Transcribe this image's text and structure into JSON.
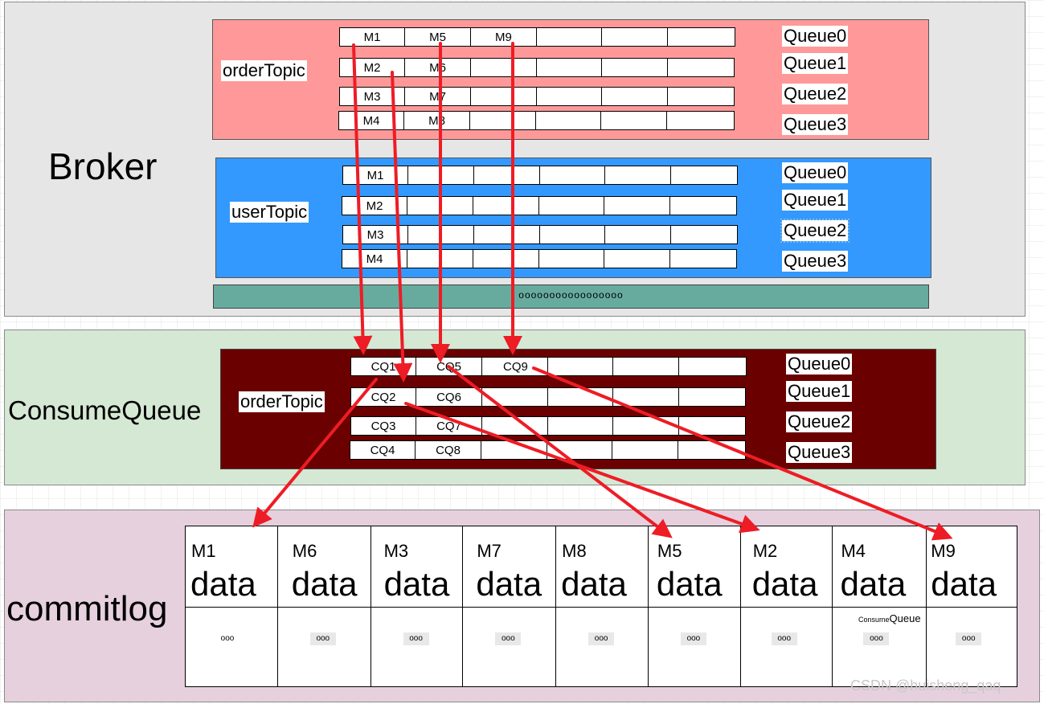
{
  "sections": {
    "broker": "Broker",
    "consume_queue": "ConsumeQueue",
    "commitlog": "commitlog"
  },
  "order_topic": {
    "label": "orderTopic",
    "queues": [
      {
        "name": "Queue0",
        "cells": [
          "M1",
          "M5",
          "M9",
          "",
          "",
          ""
        ]
      },
      {
        "name": "Queue1",
        "cells": [
          "M2",
          "M6",
          "",
          "",
          "",
          ""
        ]
      },
      {
        "name": "Queue2",
        "cells": [
          "M3",
          "M7",
          "",
          "",
          "",
          ""
        ]
      },
      {
        "name": "Queue3",
        "cells": [
          "M4",
          "M8",
          "",
          "",
          "",
          ""
        ]
      }
    ]
  },
  "user_topic": {
    "label": "userTopic",
    "queues": [
      {
        "name": "Queue0",
        "cells": [
          "M1",
          "",
          "",
          "",
          "",
          ""
        ]
      },
      {
        "name": "Queue1",
        "cells": [
          "M2",
          "",
          "",
          "",
          "",
          ""
        ]
      },
      {
        "name": "Queue2",
        "cells": [
          "M3",
          "",
          "",
          "",
          "",
          ""
        ]
      },
      {
        "name": "Queue3",
        "cells": [
          "M4",
          "",
          "",
          "",
          "",
          ""
        ]
      }
    ]
  },
  "more_topics": "ooooooooooooooooo",
  "consume_queue": {
    "label": "orderTopic",
    "queues": [
      {
        "name": "Queue0",
        "cells": [
          "CQ1",
          "CQ5",
          "CQ9",
          "",
          "",
          ""
        ]
      },
      {
        "name": "Queue1",
        "cells": [
          "CQ2",
          "CQ6",
          "",
          "",
          "",
          ""
        ]
      },
      {
        "name": "Queue2",
        "cells": [
          "CQ3",
          "CQ7",
          "",
          "",
          "",
          ""
        ]
      },
      {
        "name": "Queue3",
        "cells": [
          "CQ4",
          "CQ8",
          "",
          "",
          "",
          ""
        ]
      }
    ]
  },
  "commitlog": {
    "entries": [
      {
        "id": "M1",
        "data": "data",
        "more": "ooo"
      },
      {
        "id": "M6",
        "data": "data",
        "more": "ooo"
      },
      {
        "id": "M3",
        "data": "data",
        "more": "ooo"
      },
      {
        "id": "M7",
        "data": "data",
        "more": "ooo"
      },
      {
        "id": "M8",
        "data": "data",
        "more": "ooo"
      },
      {
        "id": "M5",
        "data": "data",
        "more": "ooo"
      },
      {
        "id": "M2",
        "data": "data",
        "more": "ooo"
      },
      {
        "id": "M4",
        "data": "data",
        "more": "ooo"
      },
      {
        "id": "M9",
        "data": "data",
        "more": "ooo"
      }
    ],
    "note_small": "Consume",
    "note_large": "Queue"
  },
  "arrow_color": "#ee1c25",
  "watermark": "CSDN @huisheng_qaq"
}
